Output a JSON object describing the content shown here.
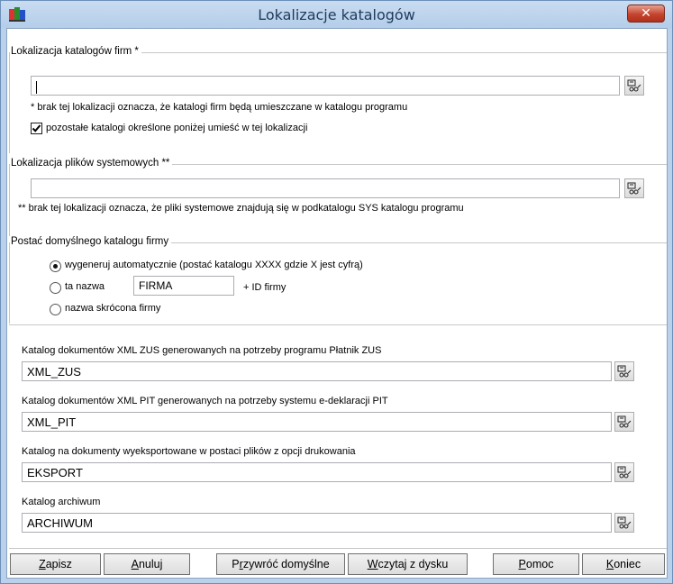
{
  "window": {
    "title": "Lokalizacje katalogów",
    "close_label": "✕"
  },
  "firm_group": {
    "label": "Lokalizacja katalogów firm *",
    "path_value": "",
    "note": "* brak tej lokalizacji oznacza, że katalogi firm będą umieszczane w katalogu programu",
    "checkbox_label": "pozostałe katalogi określone poniżej umieść w tej lokalizacji",
    "checkbox_checked": true
  },
  "system_group": {
    "label": "Lokalizacja plików systemowych **",
    "path_value": "",
    "note": "** brak tej lokalizacji oznacza, że pliki systemowe znajdują się w podkatalogu SYS katalogu programu"
  },
  "default_group": {
    "label": "Postać domyślnego katalogu firmy",
    "option_auto": "wygeneruj automatycznie (postać katalogu XXXX gdzie X jest cyfrą)",
    "option_name": "ta nazwa",
    "name_value": "FIRMA",
    "id_suffix": "+ ID firmy",
    "option_short": "nazwa skrócona firmy",
    "selected": "auto"
  },
  "folders": [
    {
      "label": "Katalog dokumentów XML ZUS generowanych na potrzeby programu Płatnik ZUS",
      "value": "XML_ZUS"
    },
    {
      "label": "Katalog dokumentów XML PIT generowanych na potrzeby systemu e-deklaracji PIT",
      "value": "XML_PIT"
    },
    {
      "label": "Katalog na dokumenty wyeksportowane w postaci plików z opcji drukowania",
      "value": "EKSPORT"
    },
    {
      "label": "Katalog archiwum",
      "value": "ARCHIWUM"
    }
  ],
  "buttons": {
    "save_hotkey": "Z",
    "save_rest": "apisz",
    "cancel_hotkey": "A",
    "cancel_rest": "nuluj",
    "restore_pre": "P",
    "restore_hotkey": "r",
    "restore_rest": "zywróć domyślne",
    "load_hotkey": "W",
    "load_rest": "czytaj z dysku",
    "help_hotkey": "P",
    "help_rest": "omoc",
    "end_hotkey": "K",
    "end_rest": "oniec"
  },
  "icons": {
    "app": "app-icon",
    "browse": "browse-folder-icon",
    "close": "close-icon"
  }
}
